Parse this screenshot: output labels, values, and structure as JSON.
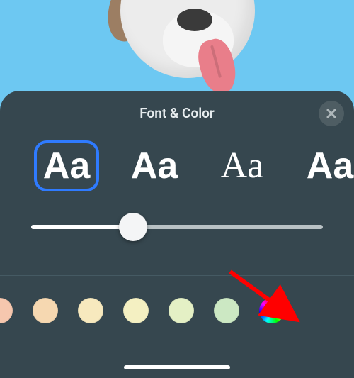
{
  "sheet": {
    "title": "Font & Color"
  },
  "fonts": [
    {
      "sample": "Aa",
      "family": "-apple-system, Helvetica, Arial, sans-serif",
      "weight": 700,
      "selected": true
    },
    {
      "sample": "Aa",
      "family": "'Avenir Next', 'Segoe UI', sans-serif",
      "weight": 600,
      "selected": false
    },
    {
      "sample": "Aa",
      "family": "Georgia, 'Times New Roman', serif",
      "weight": 500,
      "selected": false
    },
    {
      "sample": "Aa",
      "family": "'Arial Black', Impact, sans-serif",
      "weight": 800,
      "selected": false
    }
  ],
  "slider": {
    "value_percent": 35
  },
  "colors": [
    {
      "name": "peach",
      "hex": "#F6C7AE"
    },
    {
      "name": "light-orange",
      "hex": "#F6D8B1"
    },
    {
      "name": "pale-yellow",
      "hex": "#F7E9BE"
    },
    {
      "name": "cream-yellow",
      "hex": "#F4F0C2"
    },
    {
      "name": "pale-green",
      "hex": "#E4F0C5"
    },
    {
      "name": "mint",
      "hex": "#CCE8C3"
    },
    {
      "name": "color-wheel",
      "hex": null
    }
  ]
}
